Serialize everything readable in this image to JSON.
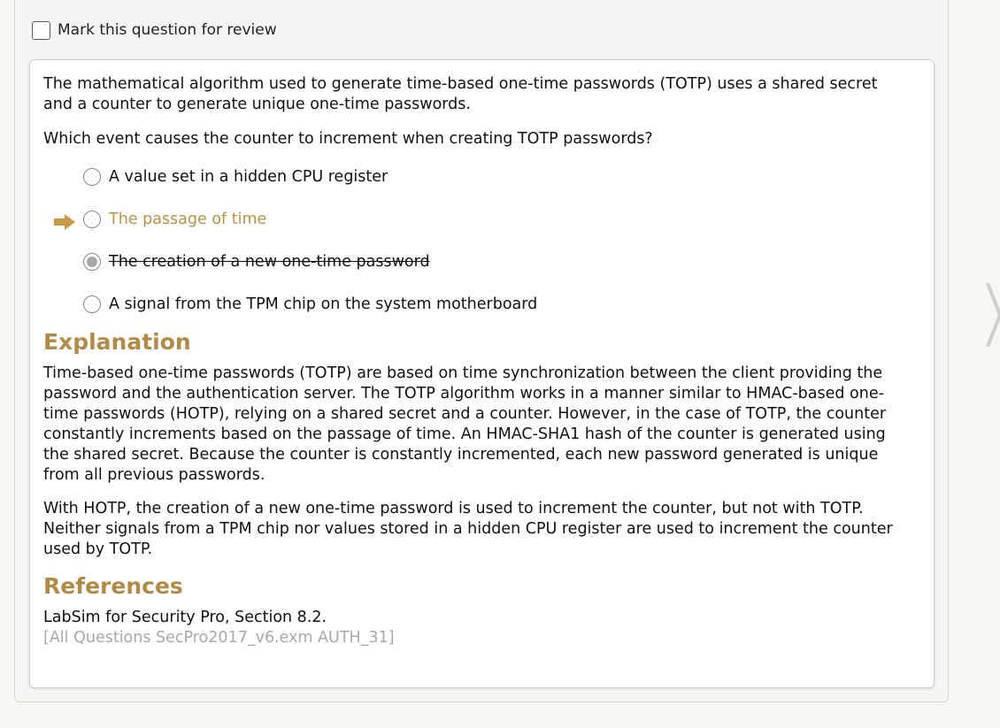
{
  "review": {
    "label": "Mark this question for review"
  },
  "question": {
    "stem": "The mathematical algorithm used to generate time-based one-time passwords (TOTP) uses a shared secret and a counter to generate unique one-time passwords.",
    "prompt": "Which event causes the counter to increment when creating TOTP passwords?",
    "options": [
      {
        "label": "A value set in a hidden CPU register",
        "state": "unselected"
      },
      {
        "label": "The passage of time",
        "state": "correct"
      },
      {
        "label": "The creation of a new one-time password",
        "state": "selected-struck"
      },
      {
        "label": "A signal from the TPM chip on the system motherboard",
        "state": "unselected"
      }
    ]
  },
  "explanation": {
    "heading": "Explanation",
    "paragraphs": [
      "Time-based one-time passwords (TOTP) are based on time synchronization between the client providing the password and the authentication server. The TOTP algorithm works in a manner similar to HMAC-based one-time passwords (HOTP), relying on a shared secret and a counter. However, in the case of TOTP, the counter constantly increments based on the passage of time. An HMAC-SHA1 hash of the counter is generated using the shared secret. Because the counter is constantly incremented, each new password generated is unique from all previous passwords.",
      "With HOTP, the creation of a new one-time password is used to increment the counter, but not with TOTP. Neither signals from a TPM chip nor values stored in a hidden CPU register are used to increment the counter used by TOTP."
    ]
  },
  "references": {
    "heading": "References",
    "source": "LabSim for Security Pro, Section 8.2.",
    "meta": "[All Questions SecPro2017_v6.exm AUTH_31]"
  },
  "colors": {
    "accent": "#b08a46",
    "correct_text": "#b8924a",
    "muted": "#a8a8a8"
  },
  "icons": {
    "correct_indicator": "arrow-right-icon",
    "next": "chevron-right-icon"
  }
}
